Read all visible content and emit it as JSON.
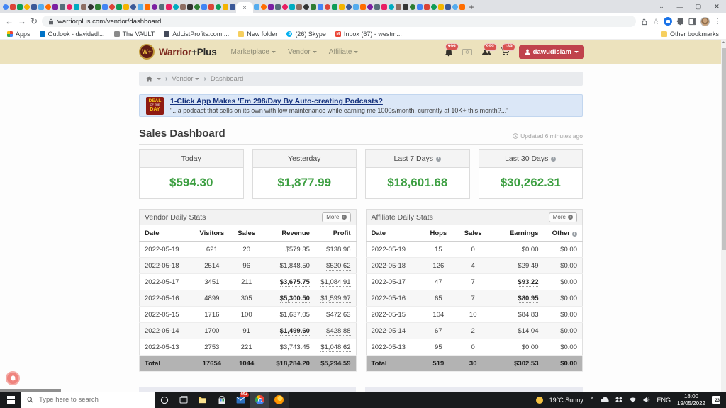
{
  "browser": {
    "url": "warriorplus.com/vendor/dashboard",
    "active_tab_close": "×",
    "new_tab": "+",
    "tab_palette": [
      "#4285f4",
      "#db4437",
      "#0f9d58",
      "#f4b400",
      "#3b5998",
      "#55acee",
      "#ff6d00",
      "#7b1fa2",
      "#546e7a",
      "#e91e63",
      "#00acc1",
      "#8d6e63",
      "#333333",
      "#2e7d32"
    ],
    "bookmarks": [
      {
        "label": "Apps",
        "icon": "apps-grid",
        "color": ""
      },
      {
        "label": "Outlook - davidedl...",
        "icon": "outlook",
        "color": "#0072c6",
        "letter": ""
      },
      {
        "label": "The VAULT",
        "icon": "globe",
        "color": "#8a8a8a",
        "letter": ""
      },
      {
        "label": "AdListProfits.com!...",
        "icon": "site",
        "color": "#444a5a",
        "letter": ""
      },
      {
        "label": "New folder",
        "icon": "folder",
        "color": "#f6cf5f"
      },
      {
        "label": "(26) Skype",
        "icon": "skype",
        "color": "#00aff0",
        "letter": "S"
      },
      {
        "label": "Inbox (67) - westm...",
        "icon": "gmail",
        "color": "#ea4335",
        "letter": "M"
      }
    ],
    "other_bookmarks": "Other bookmarks"
  },
  "site_header": {
    "brand_left": "Warrior",
    "brand_right": "+Plus",
    "nav": [
      {
        "label": "Marketplace"
      },
      {
        "label": "Vendor"
      },
      {
        "label": "Affiliate"
      }
    ],
    "badges": {
      "bell": "999",
      "users": "999",
      "cart": "189"
    },
    "user_button": "dawudislam"
  },
  "breadcrumb": {
    "vendor": "Vendor",
    "dashboard": "Dashboard"
  },
  "deal": {
    "badge_line1": "DEAL",
    "badge_line2": "OF THE",
    "badge_line3": "DAY",
    "title": "1-Click App Makes 'Em 298/Day By Auto-creating Podcasts?",
    "desc": "\"...a podcast that sells on its own with low maintenance while earning me 1000s/month, currently at 10K+ this month?...\""
  },
  "dashboard": {
    "title": "Sales Dashboard",
    "updated": "Updated 6 minutes ago",
    "value_color": "#3d9f42",
    "cards": [
      {
        "label": "Today",
        "value": "$594.30",
        "info": false
      },
      {
        "label": "Yesterday",
        "value": "$1,877.99",
        "info": false
      },
      {
        "label": "Last 7 Days",
        "value": "$18,601.68",
        "info": true
      },
      {
        "label": "Last 30 Days",
        "value": "$30,262.31",
        "info": true
      }
    ]
  },
  "vendor_stats": {
    "title": "Vendor Daily Stats",
    "more_label": "More",
    "headers": [
      {
        "label": "Date"
      },
      {
        "label": "Visitors"
      },
      {
        "label": "Sales"
      },
      {
        "label": "Revenue"
      },
      {
        "label": "Profit"
      }
    ],
    "align": [
      "l",
      "c",
      "c",
      "r",
      "r"
    ],
    "col_widths": [
      "24%",
      "19%",
      "13%",
      "25%",
      "19%"
    ],
    "rows": [
      [
        "2022-05-19",
        "621",
        "20",
        "$579.35",
        "$138.96"
      ],
      [
        "2022-05-18",
        "2514",
        "96",
        "$1,848.50",
        "$520.62"
      ],
      [
        "2022-05-17",
        "3451",
        "211",
        "$3,675.75",
        "$1,084.91"
      ],
      [
        "2022-05-16",
        "4899",
        "305",
        "$5,300.50",
        "$1,599.97"
      ],
      [
        "2022-05-15",
        "1716",
        "100",
        "$1,637.05",
        "$472.63"
      ],
      [
        "2022-05-14",
        "1700",
        "91",
        "$1,499.60",
        "$428.88"
      ],
      [
        "2022-05-13",
        "2753",
        "221",
        "$3,743.45",
        "$1,048.62"
      ]
    ],
    "bold_cells": [
      [
        2,
        3
      ],
      [
        3,
        3
      ],
      [
        5,
        3
      ]
    ],
    "dotted_cols": [
      4
    ],
    "total_label": "Total",
    "total": [
      "17654",
      "1044",
      "$18,284.20",
      "$5,294.59"
    ]
  },
  "affiliate_stats": {
    "title": "Affiliate Daily Stats",
    "more_label": "More",
    "headers": [
      {
        "label": "Date"
      },
      {
        "label": "Hops"
      },
      {
        "label": "Sales"
      },
      {
        "label": "Earnings"
      },
      {
        "label": "Other",
        "info": true
      }
    ],
    "align": [
      "l",
      "c",
      "c",
      "r",
      "r"
    ],
    "col_widths": [
      "25%",
      "17%",
      "15%",
      "25%",
      "18%"
    ],
    "rows": [
      [
        "2022-05-19",
        "15",
        "0",
        "$0.00",
        "$0.00"
      ],
      [
        "2022-05-18",
        "126",
        "4",
        "$29.49",
        "$0.00"
      ],
      [
        "2022-05-17",
        "47",
        "7",
        "$93.22",
        "$0.00"
      ],
      [
        "2022-05-16",
        "65",
        "7",
        "$80.95",
        "$0.00"
      ],
      [
        "2022-05-15",
        "104",
        "10",
        "$84.83",
        "$0.00"
      ],
      [
        "2022-05-14",
        "67",
        "2",
        "$14.04",
        "$0.00"
      ],
      [
        "2022-05-13",
        "95",
        "0",
        "$0.00",
        "$0.00"
      ]
    ],
    "bold_cells": [
      [
        2,
        3
      ],
      [
        3,
        3
      ]
    ],
    "dotted_cols": [],
    "total_label": "Total",
    "total": [
      "519",
      "30",
      "$302.53",
      "$0.00"
    ]
  },
  "taskbar": {
    "search_placeholder": "Type here to search",
    "mail_badge": "99+",
    "weather": "19°C Sunny",
    "lang": "ENG",
    "time": "18:00",
    "date": "19/05/2022",
    "notif_badge": "23"
  }
}
